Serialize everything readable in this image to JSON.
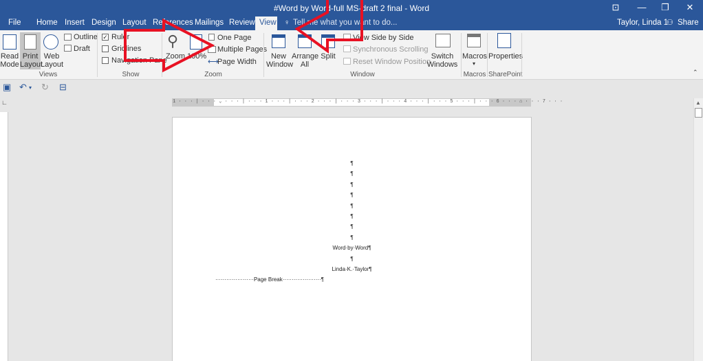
{
  "window": {
    "title": "#Word by Word-full MS-draft 2 final - Word",
    "restore_icon": "ribbon-display-icon",
    "minimize": "—",
    "maximize": "❐",
    "close": "✕"
  },
  "tabs": [
    "File",
    "Home",
    "Insert",
    "Design",
    "Layout",
    "References",
    "Mailings",
    "Review",
    "View"
  ],
  "active_tab": "View",
  "tell_me": "Tell me what you want to do...",
  "user": "Taylor, Linda 1",
  "share": "Share",
  "ribbon": {
    "views": {
      "read_mode": "Read\nMode",
      "print_layout": "Print\nLayout",
      "web_layout": "Web\nLayout",
      "outline": "Outline",
      "draft": "Draft",
      "group": "Views"
    },
    "show": {
      "ruler": "Ruler",
      "gridlines": "Gridlines",
      "navigation_pane": "Navigation Pane",
      "group": "Show",
      "ruler_checked": true
    },
    "zoom": {
      "zoom": "Zoom",
      "hundred": "100%",
      "one_page": "One Page",
      "multiple_pages": "Multiple Pages",
      "page_width": "Page Width",
      "group": "Zoom"
    },
    "window": {
      "new_window": "New\nWindow",
      "arrange_all": "Arrange\nAll",
      "split": "Split",
      "side_by_side": "View Side by Side",
      "sync_scroll": "Synchronous Scrolling",
      "reset_pos": "Reset Window Position",
      "switch_windows": "Switch\nWindows",
      "group": "Window"
    },
    "macros": {
      "label": "Macros",
      "group": "Macros"
    },
    "sharepoint": {
      "label": "Properties",
      "group": "SharePoint"
    }
  },
  "ruler_text": "1 · · · | · · · ⌄ · · · | · · · 1 · · · | · · · 2 · · · | · · · 3 · · · | · · · 4 · · · | · · · 5 · · · | · · · 6 · · · ⌂ · · · 7 · · ·",
  "document": {
    "pilcrow": "¶",
    "title_line": "Word·by·Word¶",
    "blank_line": "¶",
    "author_line": "Linda·K.·Taylor¶",
    "page_break": "·····················Page Break·····················¶"
  },
  "colors": {
    "accent": "#2b579a",
    "arrow": "#e81123"
  }
}
